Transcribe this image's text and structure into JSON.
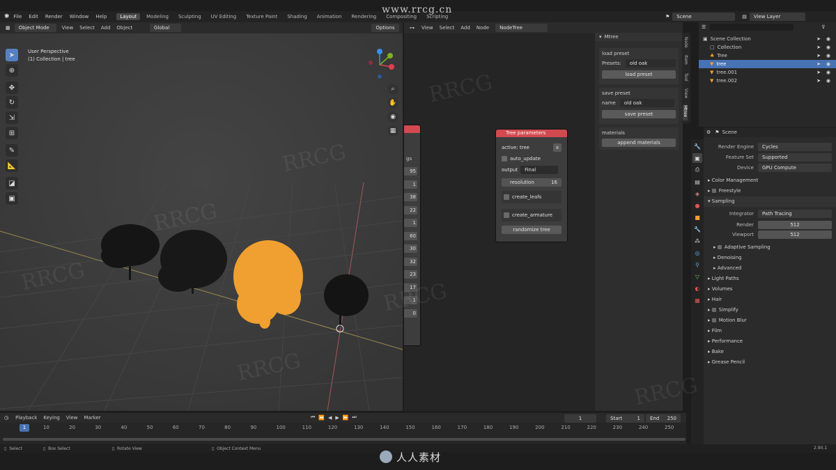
{
  "topbar": {
    "menus": [
      "File",
      "Edit",
      "Render",
      "Window",
      "Help"
    ],
    "workspaces": [
      {
        "label": "Layout",
        "active": true
      },
      {
        "label": "Modeling",
        "active": false
      },
      {
        "label": "Sculpting",
        "active": false
      },
      {
        "label": "UV Editing",
        "active": false
      },
      {
        "label": "Texture Paint",
        "active": false
      },
      {
        "label": "Shading",
        "active": false
      },
      {
        "label": "Animation",
        "active": false
      },
      {
        "label": "Rendering",
        "active": false
      },
      {
        "label": "Compositing",
        "active": false
      },
      {
        "label": "Scripting",
        "active": false
      }
    ],
    "scene": "Scene",
    "view_layer": "View Layer"
  },
  "viewport": {
    "mode": "Object Mode",
    "menus": [
      "View",
      "Select",
      "Add",
      "Object"
    ],
    "transform": "Global",
    "options_label": "Options",
    "overlay_line1": "User Perspective",
    "overlay_line2": "(1) Collection | tree",
    "nav_icons": [
      "zoom-icon",
      "hand-icon",
      "camera-icon",
      "grid-icon"
    ],
    "gizmo": {
      "x_color": "#e0404f",
      "y_color": "#7ab41f",
      "z_color": "#3b8ee8"
    }
  },
  "node_editor": {
    "menus": [
      "View",
      "Select",
      "Add",
      "Node"
    ],
    "tree_name": "NodeTree",
    "left_node_label": "gs",
    "left_node_values": [
      "95",
      "1",
      "38",
      "22",
      "1",
      "60",
      "30",
      "32",
      "23",
      "17",
      "1",
      "0"
    ],
    "tree_node": {
      "title": "Tree parameters",
      "active_label": "active: tree",
      "auto_update": "auto_update",
      "output_label": "output",
      "output_value": "Final",
      "resolution_label": "resolution",
      "resolution_value": "16",
      "create_leafs": "create_leafs",
      "create_armature": "create_armature",
      "randomize_button": "randomize tree"
    },
    "n_panel": {
      "header": "Mtree",
      "load_preset_label": "load preset",
      "presets_label": "Presets:",
      "presets_value": "old oak",
      "load_button": "load preset",
      "save_preset_label": "save preset",
      "name_label": "name",
      "name_value": "old oak",
      "save_button": "save preset",
      "materials_label": "materials",
      "materials_button": "append materials",
      "side_tabs": [
        "Node",
        "Item",
        "Tool",
        "View",
        "Mtree"
      ]
    }
  },
  "outliner": {
    "rows": [
      {
        "label": "Scene Collection",
        "selected": false,
        "indent": 0
      },
      {
        "label": "Collection",
        "selected": false,
        "indent": 1
      },
      {
        "label": "Tree",
        "selected": false,
        "indent": 1
      },
      {
        "label": "tree",
        "selected": true,
        "indent": 1
      },
      {
        "label": "tree.001",
        "selected": false,
        "indent": 1
      },
      {
        "label": "tree.002",
        "selected": false,
        "indent": 1
      }
    ]
  },
  "properties": {
    "scene_label": "Scene",
    "render_engine_label": "Render Engine",
    "render_engine": "Cycles",
    "feature_set_label": "Feature Set",
    "feature_set": "Supported",
    "device_label": "Device",
    "device": "GPU Compute",
    "panels": [
      "Color Management",
      "Freestyle",
      "Sampling"
    ],
    "integrator_label": "Integrator",
    "integrator": "Path Tracing",
    "render_label": "Render",
    "render_samples": "512",
    "viewport_label": "Viewport",
    "viewport_samples": "512",
    "sub_panels": [
      "Adaptive Sampling",
      "Denoising",
      "Advanced"
    ],
    "more_panels": [
      "Light Paths",
      "Volumes",
      "Hair",
      "Simplify",
      "Motion Blur",
      "Film",
      "Performance",
      "Bake",
      "Grease Pencil"
    ]
  },
  "timeline": {
    "menus": [
      "Playback",
      "Keying",
      "View",
      "Marker"
    ],
    "current_frame": "1",
    "start_label": "Start",
    "start_value": "1",
    "end_label": "End",
    "end_value": "250",
    "ticks": [
      "10",
      "20",
      "30",
      "40",
      "50",
      "60",
      "70",
      "80",
      "90",
      "100",
      "110",
      "120",
      "130",
      "140",
      "150",
      "160",
      "170",
      "180",
      "190",
      "200",
      "210",
      "220",
      "230",
      "240",
      "250"
    ]
  },
  "status": {
    "select": "Select",
    "box_select": "Box Select",
    "rotate_view": "Rotate View",
    "context_menu": "Object Context Menu",
    "version": "2.90.1"
  },
  "watermarks": {
    "top_url": "www.rrcg.cn",
    "brand": "RRCG",
    "bottom_logo": "人人素材"
  },
  "colors": {
    "accent_blue": "#4772b3",
    "node_red": "#d24a4f",
    "tree_orange": "#f0a030"
  }
}
